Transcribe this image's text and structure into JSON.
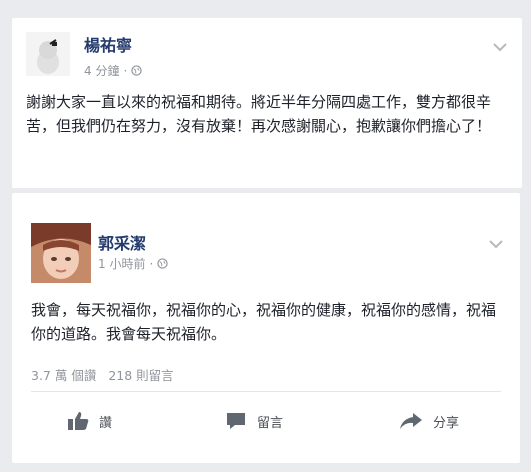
{
  "post": {
    "author": "楊祐寧",
    "time": "4 分鐘",
    "text": "謝謝大家一直以來的祝福和期待。將近半年分隔四處工作，雙方都很辛苦，但我們仍在努力，沒有放棄！再次感謝關心，抱歉讓你們擔心了！"
  },
  "reply": {
    "author": "郭采潔",
    "time": "1 小時前",
    "text": "我會，每天祝福你，祝福你的心，祝福你的健康，祝福你的感情，祝福你的道路。我會每天祝福你。",
    "reads": "3.7 萬 個讚",
    "comments": "218 則留言",
    "actions": {
      "like": "讚",
      "comment": "留言",
      "share": "分享"
    }
  },
  "icons": [
    "avatar",
    "globe-icon",
    "chevron-down-icon",
    "thumbs-up-icon",
    "comment-icon",
    "share-icon"
  ],
  "colors": {
    "name": "#233b6d",
    "meta": "#90949c",
    "background": "#e9ebee"
  }
}
